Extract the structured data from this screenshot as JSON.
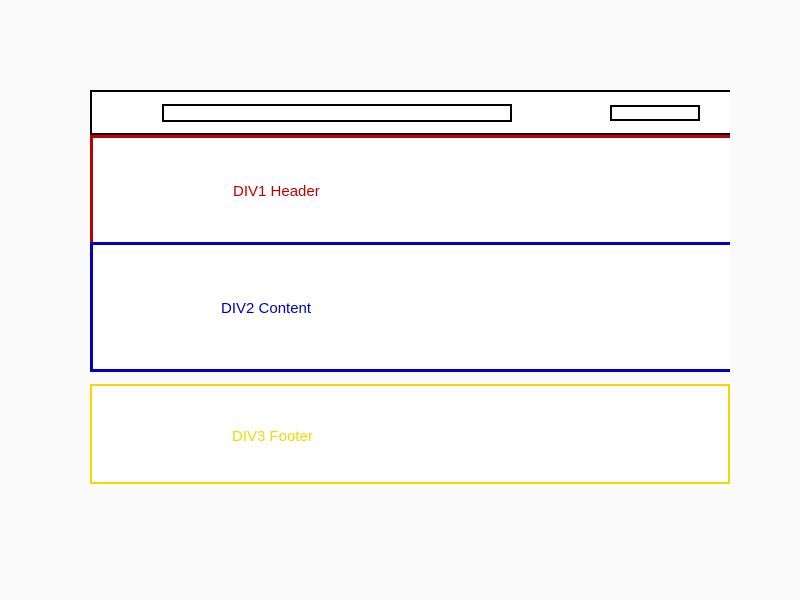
{
  "sections": {
    "div1": {
      "label": "DIV1 Header",
      "color": "#c00000"
    },
    "div2": {
      "label": "DIV2 Content",
      "color": "#0000c0"
    },
    "div3": {
      "label": "DIV3 Footer",
      "color": "#f5d800"
    }
  }
}
